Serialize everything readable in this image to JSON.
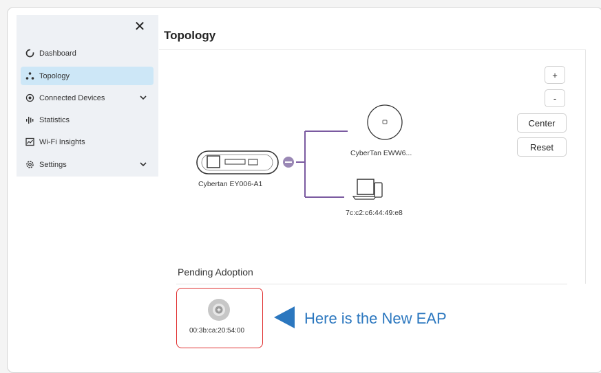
{
  "sidebar": {
    "close_label": "✕",
    "items": [
      {
        "label": "Dashboard",
        "icon": "dashboard-ring-icon"
      },
      {
        "label": "Topology",
        "icon": "topology-dots-icon",
        "active": true
      },
      {
        "label": "Connected Devices",
        "icon": "target-circle-icon",
        "expandable": true
      },
      {
        "label": "Statistics",
        "icon": "bars-icon"
      },
      {
        "label": "Wi-Fi Insights",
        "icon": "chart-window-icon"
      },
      {
        "label": "Settings",
        "icon": "gear-icon",
        "expandable": true
      }
    ]
  },
  "main": {
    "title": "Topology"
  },
  "controls": {
    "zoom_in": "+",
    "zoom_out": "-",
    "center": "Center",
    "reset": "Reset"
  },
  "topology": {
    "router_label": "Cybertan EY006-A1",
    "access_point_label": "CyberTan EWW6...",
    "client_label": "7c:c2:c6:44:49:e8"
  },
  "pending": {
    "title": "Pending Adoption",
    "device_mac": "00:3b:ca:20:54:00",
    "callout": "Here is the New EAP"
  },
  "colors": {
    "accent": "#cde7f7",
    "link_line": "#7a5aa0",
    "collapse_button": "#9a88b5",
    "highlight": "#e03030",
    "callout": "#2b77bf"
  }
}
